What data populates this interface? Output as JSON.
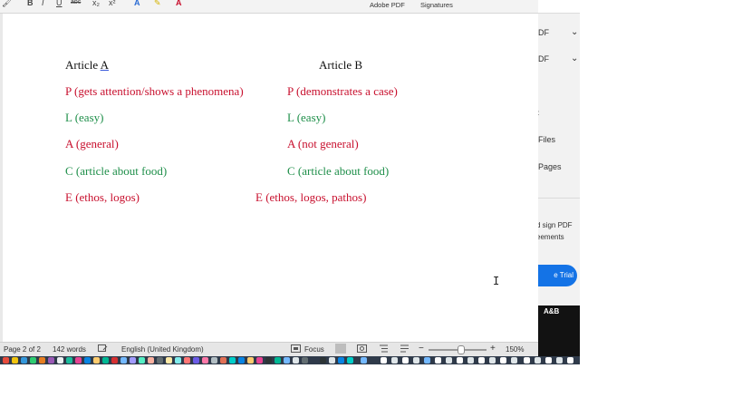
{
  "ribbon": {
    "icons": [
      {
        "name": "format-painter-icon",
        "glyph": "🖌"
      },
      {
        "name": "bold-icon",
        "glyph": "B"
      },
      {
        "name": "italic-icon",
        "glyph": "I"
      },
      {
        "name": "underline-icon",
        "glyph": "U"
      },
      {
        "name": "strikethrough-icon",
        "glyph": "abc"
      },
      {
        "name": "subscript-icon",
        "glyph": "x₂"
      },
      {
        "name": "superscript-icon",
        "glyph": "x²"
      },
      {
        "name": "text-effects-icon",
        "glyph": "A"
      },
      {
        "name": "highlight-icon",
        "glyph": "✎"
      },
      {
        "name": "font-color-icon",
        "glyph": "A"
      }
    ],
    "adobe_pdf_label": "Adobe PDF",
    "signatures_label": "Signatures"
  },
  "document": {
    "article_a_title": "Article ",
    "article_a_letter": "A",
    "article_b_title": "Article B",
    "left": [
      {
        "text": "P (gets attention/shows a phenomena)",
        "color": "red"
      },
      {
        "text": "L (easy)",
        "color": "green"
      },
      {
        "text": "A (general)",
        "color": "red"
      },
      {
        "text": "C (article about food)",
        "color": "green"
      },
      {
        "text": "E (ethos, logos)",
        "color": "red"
      }
    ],
    "right": [
      {
        "text": "P (demonstrates a case)",
        "color": "red"
      },
      {
        "text": "L (easy)",
        "color": "green"
      },
      {
        "text": "A (not general)",
        "color": "red"
      },
      {
        "text": "C (article about food)",
        "color": "green"
      },
      {
        "text": "E (ethos, logos, pathos)",
        "color": "red"
      }
    ]
  },
  "status_bar": {
    "page": "Page 2 of 2",
    "words": "142 words",
    "language": "English (United Kingdom)",
    "focus": "Focus",
    "zoom": "150%",
    "zoom_minus": "−",
    "zoom_plus": "+"
  },
  "right_panel": {
    "pdf_1": "DF",
    "pdf_2": "DF",
    "files": "Files",
    "pages": "Pages",
    "sign_line1": "d sign PDF",
    "sign_line2": "eements",
    "trial_button": "e Trial",
    "ab_label": "A&B"
  },
  "colors": {
    "red": "#c8102e",
    "green": "#1f8f4a",
    "accent_blue": "#1473e6"
  }
}
